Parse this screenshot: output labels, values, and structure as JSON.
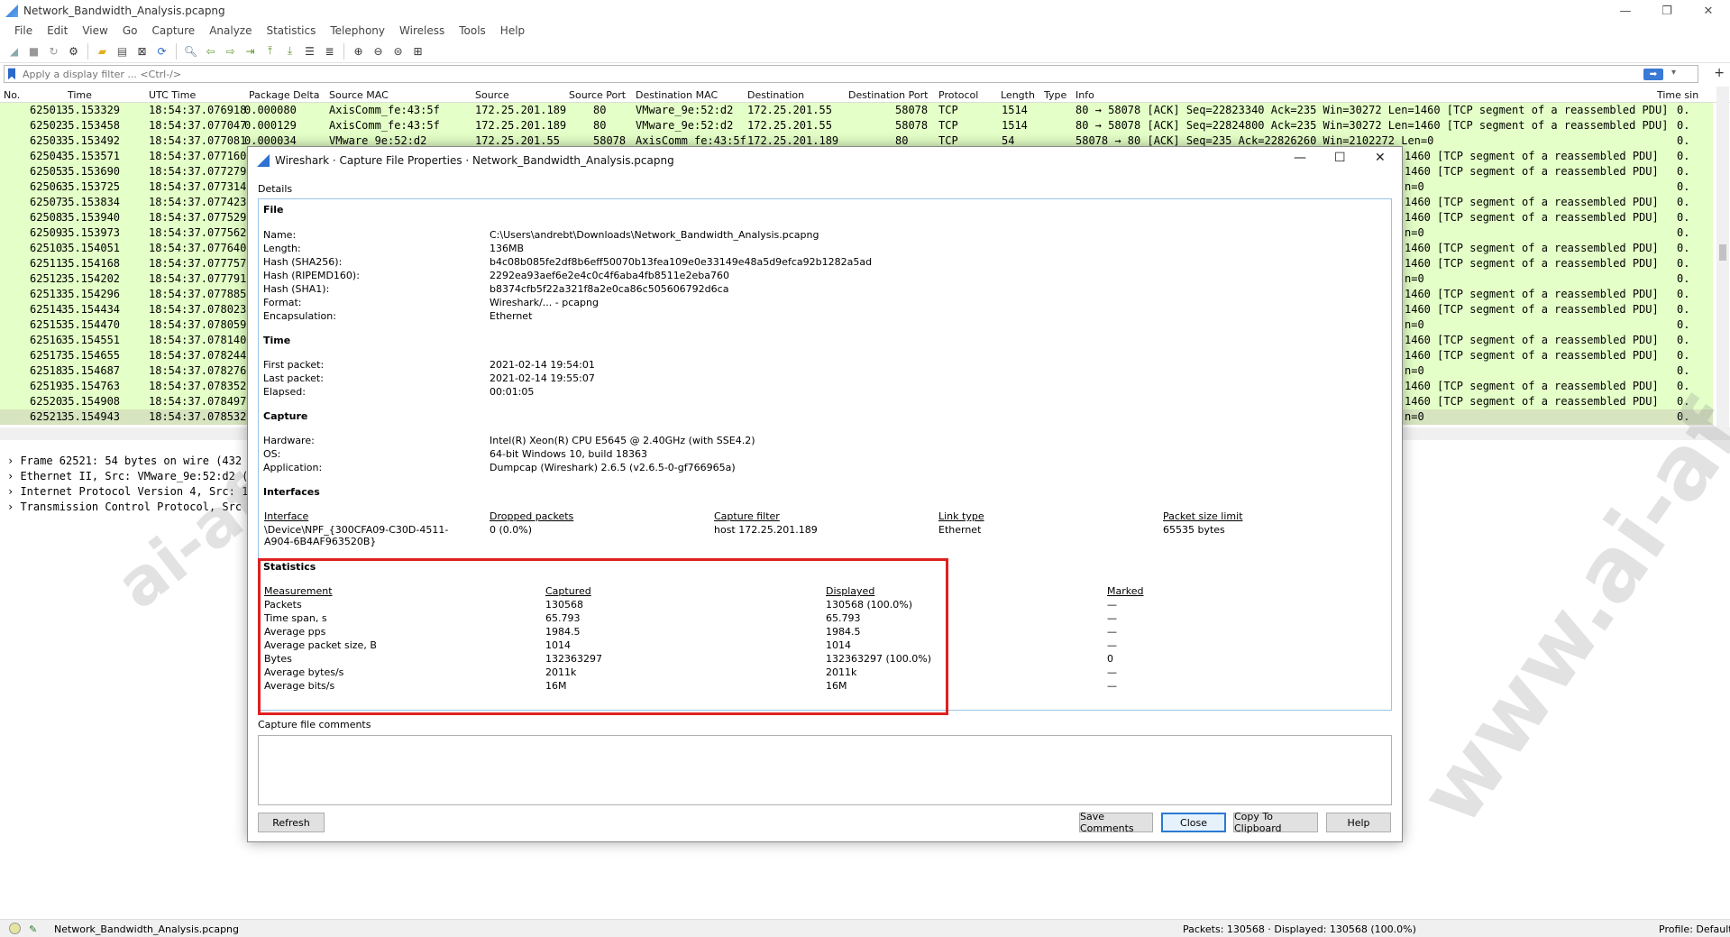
{
  "window": {
    "title": "Network_Bandwidth_Analysis.pcapng"
  },
  "menu": [
    "File",
    "Edit",
    "View",
    "Go",
    "Capture",
    "Analyze",
    "Statistics",
    "Telephony",
    "Wireless",
    "Tools",
    "Help"
  ],
  "filter": {
    "placeholder": "Apply a display filter ... <Ctrl-/>"
  },
  "columns": [
    "No.",
    "Time",
    "UTC Time",
    "Package Delta",
    "Source MAC",
    "Source",
    "Source Port",
    "Destination MAC",
    "Destination",
    "Destination Port",
    "Protocol",
    "Length",
    "Type",
    "Info",
    "Time sin"
  ],
  "packets": [
    {
      "no": "62501",
      "time": "35.153329",
      "utc": "18:54:37.076918",
      "delta": "0.000080",
      "smac": "AxisComm_fe:43:5f",
      "src": "172.25.201.189",
      "sport": "80",
      "dmac": "VMware_9e:52:d2",
      "dst": "172.25.201.55",
      "dport": "58078",
      "proto": "TCP",
      "len": "1514",
      "info": "80 → 58078 [ACK] Seq=22823340 Ack=235 Win=30272 Len=1460 [TCP segment of a reassembled PDU]",
      "ts": "0."
    },
    {
      "no": "62502",
      "time": "35.153458",
      "utc": "18:54:37.077047",
      "delta": "0.000129",
      "smac": "AxisComm_fe:43:5f",
      "src": "172.25.201.189",
      "sport": "80",
      "dmac": "VMware_9e:52:d2",
      "dst": "172.25.201.55",
      "dport": "58078",
      "proto": "TCP",
      "len": "1514",
      "info": "80 → 58078 [ACK] Seq=22824800 Ack=235 Win=30272 Len=1460 [TCP segment of a reassembled PDU]",
      "ts": "0."
    },
    {
      "no": "62503",
      "time": "35.153492",
      "utc": "18:54:37.077081",
      "delta": "0.000034",
      "smac": "VMware_9e:52:d2",
      "src": "172.25.201.55",
      "sport": "58078",
      "dmac": "AxisComm_fe:43:5f",
      "dst": "172.25.201.189",
      "dport": "80",
      "proto": "TCP",
      "len": "54",
      "info": "58078 → 80 [ACK] Seq=235 Ack=22826260 Win=2102272 Len=0",
      "ts": "0."
    },
    {
      "no": "62504",
      "time": "35.153571",
      "utc": "18:54:37.077160",
      "info": "1460 [TCP segment of a reassembled PDU]",
      "ts": "0."
    },
    {
      "no": "62505",
      "time": "35.153690",
      "utc": "18:54:37.077279",
      "info": "1460 [TCP segment of a reassembled PDU]",
      "ts": "0."
    },
    {
      "no": "62506",
      "time": "35.153725",
      "utc": "18:54:37.077314",
      "info": "n=0",
      "ts": "0."
    },
    {
      "no": "62507",
      "time": "35.153834",
      "utc": "18:54:37.077423",
      "info": "1460 [TCP segment of a reassembled PDU]",
      "ts": "0."
    },
    {
      "no": "62508",
      "time": "35.153940",
      "utc": "18:54:37.077529",
      "info": "1460 [TCP segment of a reassembled PDU]",
      "ts": "0."
    },
    {
      "no": "62509",
      "time": "35.153973",
      "utc": "18:54:37.077562",
      "info": "n=0",
      "ts": "0."
    },
    {
      "no": "62510",
      "time": "35.154051",
      "utc": "18:54:37.077640",
      "info": "1460 [TCP segment of a reassembled PDU]",
      "ts": "0."
    },
    {
      "no": "62511",
      "time": "35.154168",
      "utc": "18:54:37.077757",
      "info": "1460 [TCP segment of a reassembled PDU]",
      "ts": "0."
    },
    {
      "no": "62512",
      "time": "35.154202",
      "utc": "18:54:37.077791",
      "info": "n=0",
      "ts": "0."
    },
    {
      "no": "62513",
      "time": "35.154296",
      "utc": "18:54:37.077885",
      "info": "1460 [TCP segment of a reassembled PDU]",
      "ts": "0."
    },
    {
      "no": "62514",
      "time": "35.154434",
      "utc": "18:54:37.078023",
      "info": "1460 [TCP segment of a reassembled PDU]",
      "ts": "0."
    },
    {
      "no": "62515",
      "time": "35.154470",
      "utc": "18:54:37.078059",
      "info": "n=0",
      "ts": "0."
    },
    {
      "no": "62516",
      "time": "35.154551",
      "utc": "18:54:37.078140",
      "info": "1460 [TCP segment of a reassembled PDU]",
      "ts": "0."
    },
    {
      "no": "62517",
      "time": "35.154655",
      "utc": "18:54:37.078244",
      "info": "1460 [TCP segment of a reassembled PDU]",
      "ts": "0."
    },
    {
      "no": "62518",
      "time": "35.154687",
      "utc": "18:54:37.078276",
      "info": "n=0",
      "ts": "0."
    },
    {
      "no": "62519",
      "time": "35.154763",
      "utc": "18:54:37.078352",
      "info": "1460 [TCP segment of a reassembled PDU]",
      "ts": "0."
    },
    {
      "no": "62520",
      "time": "35.154908",
      "utc": "18:54:37.078497",
      "info": "1460 [TCP segment of a reassembled PDU]",
      "ts": "0."
    },
    {
      "no": "62521",
      "time": "35.154943",
      "utc": "18:54:37.078532",
      "info": "n=0",
      "ts": "0."
    }
  ],
  "detail_tree": [
    "Frame 62521: 54 bytes on wire (432 b",
    "Ethernet II, Src: VMware_9e:52:d2 (0",
    "Internet Protocol Version 4, Src: 17",
    "Transmission Control Protocol, Src P"
  ],
  "status": {
    "file": "Network_Bandwidth_Analysis.pcapng",
    "packets": "Packets: 130568 · Displayed: 130568 (100.0%)",
    "profile": "Profile: Default"
  },
  "watermark": {
    "text": "www.ai-af.cn",
    "logo": "ai-af"
  },
  "dialog": {
    "title": "Wireshark · Capture File Properties · Network_Bandwidth_Analysis.pcapng",
    "details_label": "Details",
    "file_section": "File",
    "file": [
      {
        "k": "Name:",
        "v": "C:\\Users\\andrebt\\Downloads\\Network_Bandwidth_Analysis.pcapng"
      },
      {
        "k": "Length:",
        "v": "136MB"
      },
      {
        "k": "Hash (SHA256):",
        "v": "b4c08b085fe2df8b6eff50070b13fea109e0e33149e48a5d9efca92b1282a5ad"
      },
      {
        "k": "Hash (RIPEMD160):",
        "v": "2292ea93aef6e2e4c0c4f6aba4fb8511e2eba760"
      },
      {
        "k": "Hash (SHA1):",
        "v": "b8374cfb5f22a321f8a2e0ca86c505606792d6ca"
      },
      {
        "k": "Format:",
        "v": "Wireshark/... - pcapng"
      },
      {
        "k": "Encapsulation:",
        "v": "Ethernet"
      }
    ],
    "time_section": "Time",
    "time": [
      {
        "k": "First packet:",
        "v": "2021-02-14 19:54:01"
      },
      {
        "k": "Last packet:",
        "v": "2021-02-14 19:55:07"
      },
      {
        "k": "Elapsed:",
        "v": "00:01:05"
      }
    ],
    "capture_section": "Capture",
    "capture": [
      {
        "k": "Hardware:",
        "v": "Intel(R) Xeon(R) CPU E5645 @ 2.40GHz (with SSE4.2)"
      },
      {
        "k": "OS:",
        "v": "64-bit Windows 10, build 18363"
      },
      {
        "k": "Application:",
        "v": "Dumpcap (Wireshark) 2.6.5 (v2.6.5-0-gf766965a)"
      }
    ],
    "interfaces_section": "Interfaces",
    "interfaces_headers": [
      "Interface",
      "Dropped packets",
      "Capture filter",
      "Link type",
      "Packet size limit"
    ],
    "interfaces_row": [
      "\\Device\\NPF_{300CFA09-C30D-4511-",
      "A904-6B4AF963520B}",
      "0 (0.0%)",
      "host 172.25.201.189",
      "Ethernet",
      "65535 bytes"
    ],
    "statistics_section": "Statistics",
    "stats_headers": [
      "Measurement",
      "Captured",
      "Displayed",
      "Marked"
    ],
    "stats": [
      [
        "Packets",
        "130568",
        "130568 (100.0%)",
        "—"
      ],
      [
        "Time span, s",
        "65.793",
        "65.793",
        "—"
      ],
      [
        "Average pps",
        "1984.5",
        "1984.5",
        "—"
      ],
      [
        "Average packet size, B",
        "1014",
        "1014",
        "—"
      ],
      [
        "Bytes",
        "132363297",
        "132363297 (100.0%)",
        "0"
      ],
      [
        "Average bytes/s",
        "2011k",
        "2011k",
        "—"
      ],
      [
        "Average bits/s",
        "16M",
        "16M",
        "—"
      ]
    ],
    "comments_label": "Capture file comments",
    "buttons": {
      "refresh": "Refresh",
      "save": "Save Comments",
      "close": "Close",
      "copy": "Copy To Clipboard",
      "help": "Help"
    }
  }
}
